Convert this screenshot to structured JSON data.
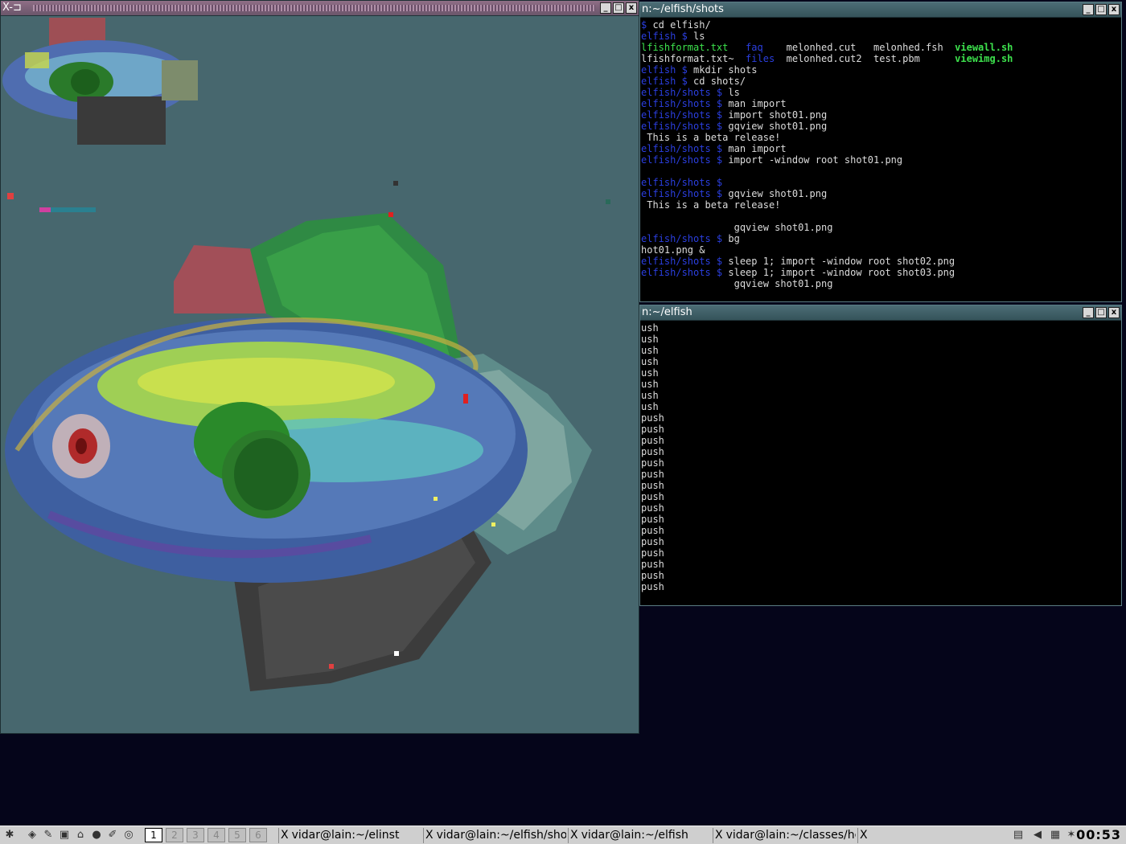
{
  "viewer": {
    "title_icon": "X-⊐",
    "buttons": [
      "_",
      "□",
      "x"
    ]
  },
  "term1": {
    "title": "n:~/elfish/shots",
    "lines": [
      [
        {
          "c": "prompt",
          "t": "$ "
        },
        {
          "c": "",
          "t": "cd elfish/"
        }
      ],
      [
        {
          "c": "prompt",
          "t": "elfish $ "
        },
        {
          "c": "",
          "t": "ls"
        }
      ],
      [
        {
          "c": "greenf",
          "t": "lfishformat.txt   "
        },
        {
          "c": "bluef",
          "t": "faq    "
        },
        {
          "c": "",
          "t": "melonhed.cut   melonhed.fsh  "
        },
        {
          "c": "greenb",
          "t": "viewall.sh"
        }
      ],
      [
        {
          "c": "",
          "t": "lfishformat.txt~  "
        },
        {
          "c": "bluef",
          "t": "files  "
        },
        {
          "c": "",
          "t": "melonhed.cut2  test.pbm      "
        },
        {
          "c": "greenb",
          "t": "viewimg.sh"
        }
      ],
      [
        {
          "c": "prompt",
          "t": "elfish $ "
        },
        {
          "c": "",
          "t": "mkdir shots"
        }
      ],
      [
        {
          "c": "prompt",
          "t": "elfish $ "
        },
        {
          "c": "",
          "t": "cd shots/"
        }
      ],
      [
        {
          "c": "prompt",
          "t": "elfish/shots $ "
        },
        {
          "c": "",
          "t": "ls"
        }
      ],
      [
        {
          "c": "prompt",
          "t": "elfish/shots $ "
        },
        {
          "c": "",
          "t": "man import"
        }
      ],
      [
        {
          "c": "prompt",
          "t": "elfish/shots $ "
        },
        {
          "c": "",
          "t": "import shot01.png"
        }
      ],
      [
        {
          "c": "prompt",
          "t": "elfish/shots $ "
        },
        {
          "c": "",
          "t": "gqview shot01.png"
        }
      ],
      [
        {
          "c": "",
          "t": " This is a beta release!"
        }
      ],
      [
        {
          "c": "prompt",
          "t": "elfish/shots $ "
        },
        {
          "c": "",
          "t": "man import"
        }
      ],
      [
        {
          "c": "prompt",
          "t": "elfish/shots $ "
        },
        {
          "c": "",
          "t": "import -window root shot01.png"
        }
      ],
      [
        {
          "c": "",
          "t": ""
        }
      ],
      [
        {
          "c": "prompt",
          "t": "elfish/shots $ "
        }
      ],
      [
        {
          "c": "prompt",
          "t": "elfish/shots $ "
        },
        {
          "c": "",
          "t": "gqview shot01.png"
        }
      ],
      [
        {
          "c": "",
          "t": " This is a beta release!"
        }
      ],
      [
        {
          "c": "",
          "t": ""
        }
      ],
      [
        {
          "c": "",
          "t": "                gqview shot01.png"
        }
      ],
      [
        {
          "c": "prompt",
          "t": "elfish/shots $ "
        },
        {
          "c": "",
          "t": "bg"
        }
      ],
      [
        {
          "c": "",
          "t": "hot01.png &"
        }
      ],
      [
        {
          "c": "prompt",
          "t": "elfish/shots $ "
        },
        {
          "c": "",
          "t": "sleep 1; import -window root shot02.png"
        }
      ],
      [
        {
          "c": "prompt",
          "t": "elfish/shots $ "
        },
        {
          "c": "",
          "t": "sleep 1; import -window root shot03.png"
        }
      ],
      [
        {
          "c": "",
          "t": "                gqview shot01.png"
        }
      ]
    ]
  },
  "term2": {
    "title": "n:~/elfish",
    "lines": [
      "ush",
      "ush",
      "ush",
      "ush",
      "ush",
      "ush",
      "ush",
      "ush",
      "push",
      "push",
      "push",
      "push",
      "push",
      "push",
      "push",
      "push",
      "push",
      "push",
      "push",
      "push",
      "push",
      "push",
      "push",
      "push"
    ]
  },
  "taskbar": {
    "desktops": [
      "1",
      "2",
      "3",
      "4",
      "5",
      "6"
    ],
    "tasks": [
      {
        "label": "vidar@lain:~/elinst"
      },
      {
        "label": "vidar@lain:~/elfish/shots"
      },
      {
        "label": "vidar@lain:~/elfish"
      },
      {
        "label": "vidar@lain:~/classes/hc"
      },
      {
        "label": ""
      }
    ],
    "clock": "00:53"
  }
}
